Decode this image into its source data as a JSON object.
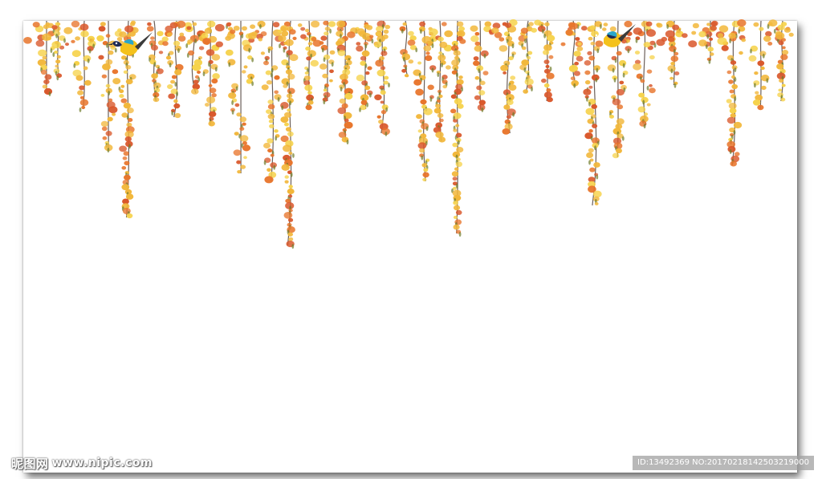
{
  "image": {
    "description_tags": [
      "hanging-flower-vines",
      "yellow-birds"
    ],
    "colors": {
      "background": "#ffffff",
      "frame_shadow": "#555555",
      "blossom_orange": "#e8742a",
      "blossom_gold": "#f2b73a",
      "blossom_yellow": "#f6d24a",
      "stem": "#3a2a22",
      "bird_body": "#f4c21c",
      "bird_head": "#1f2b55",
      "bird_wing": "#2aa6c9"
    },
    "birds": [
      {
        "name": "bird-left",
        "facing": "left"
      },
      {
        "name": "bird-right",
        "facing": "right"
      }
    ]
  },
  "watermark": {
    "site_logo": "昵图网",
    "site_url": "www.nipic.com",
    "id_text": "ID:13492369 NO:20170218142503219000"
  }
}
